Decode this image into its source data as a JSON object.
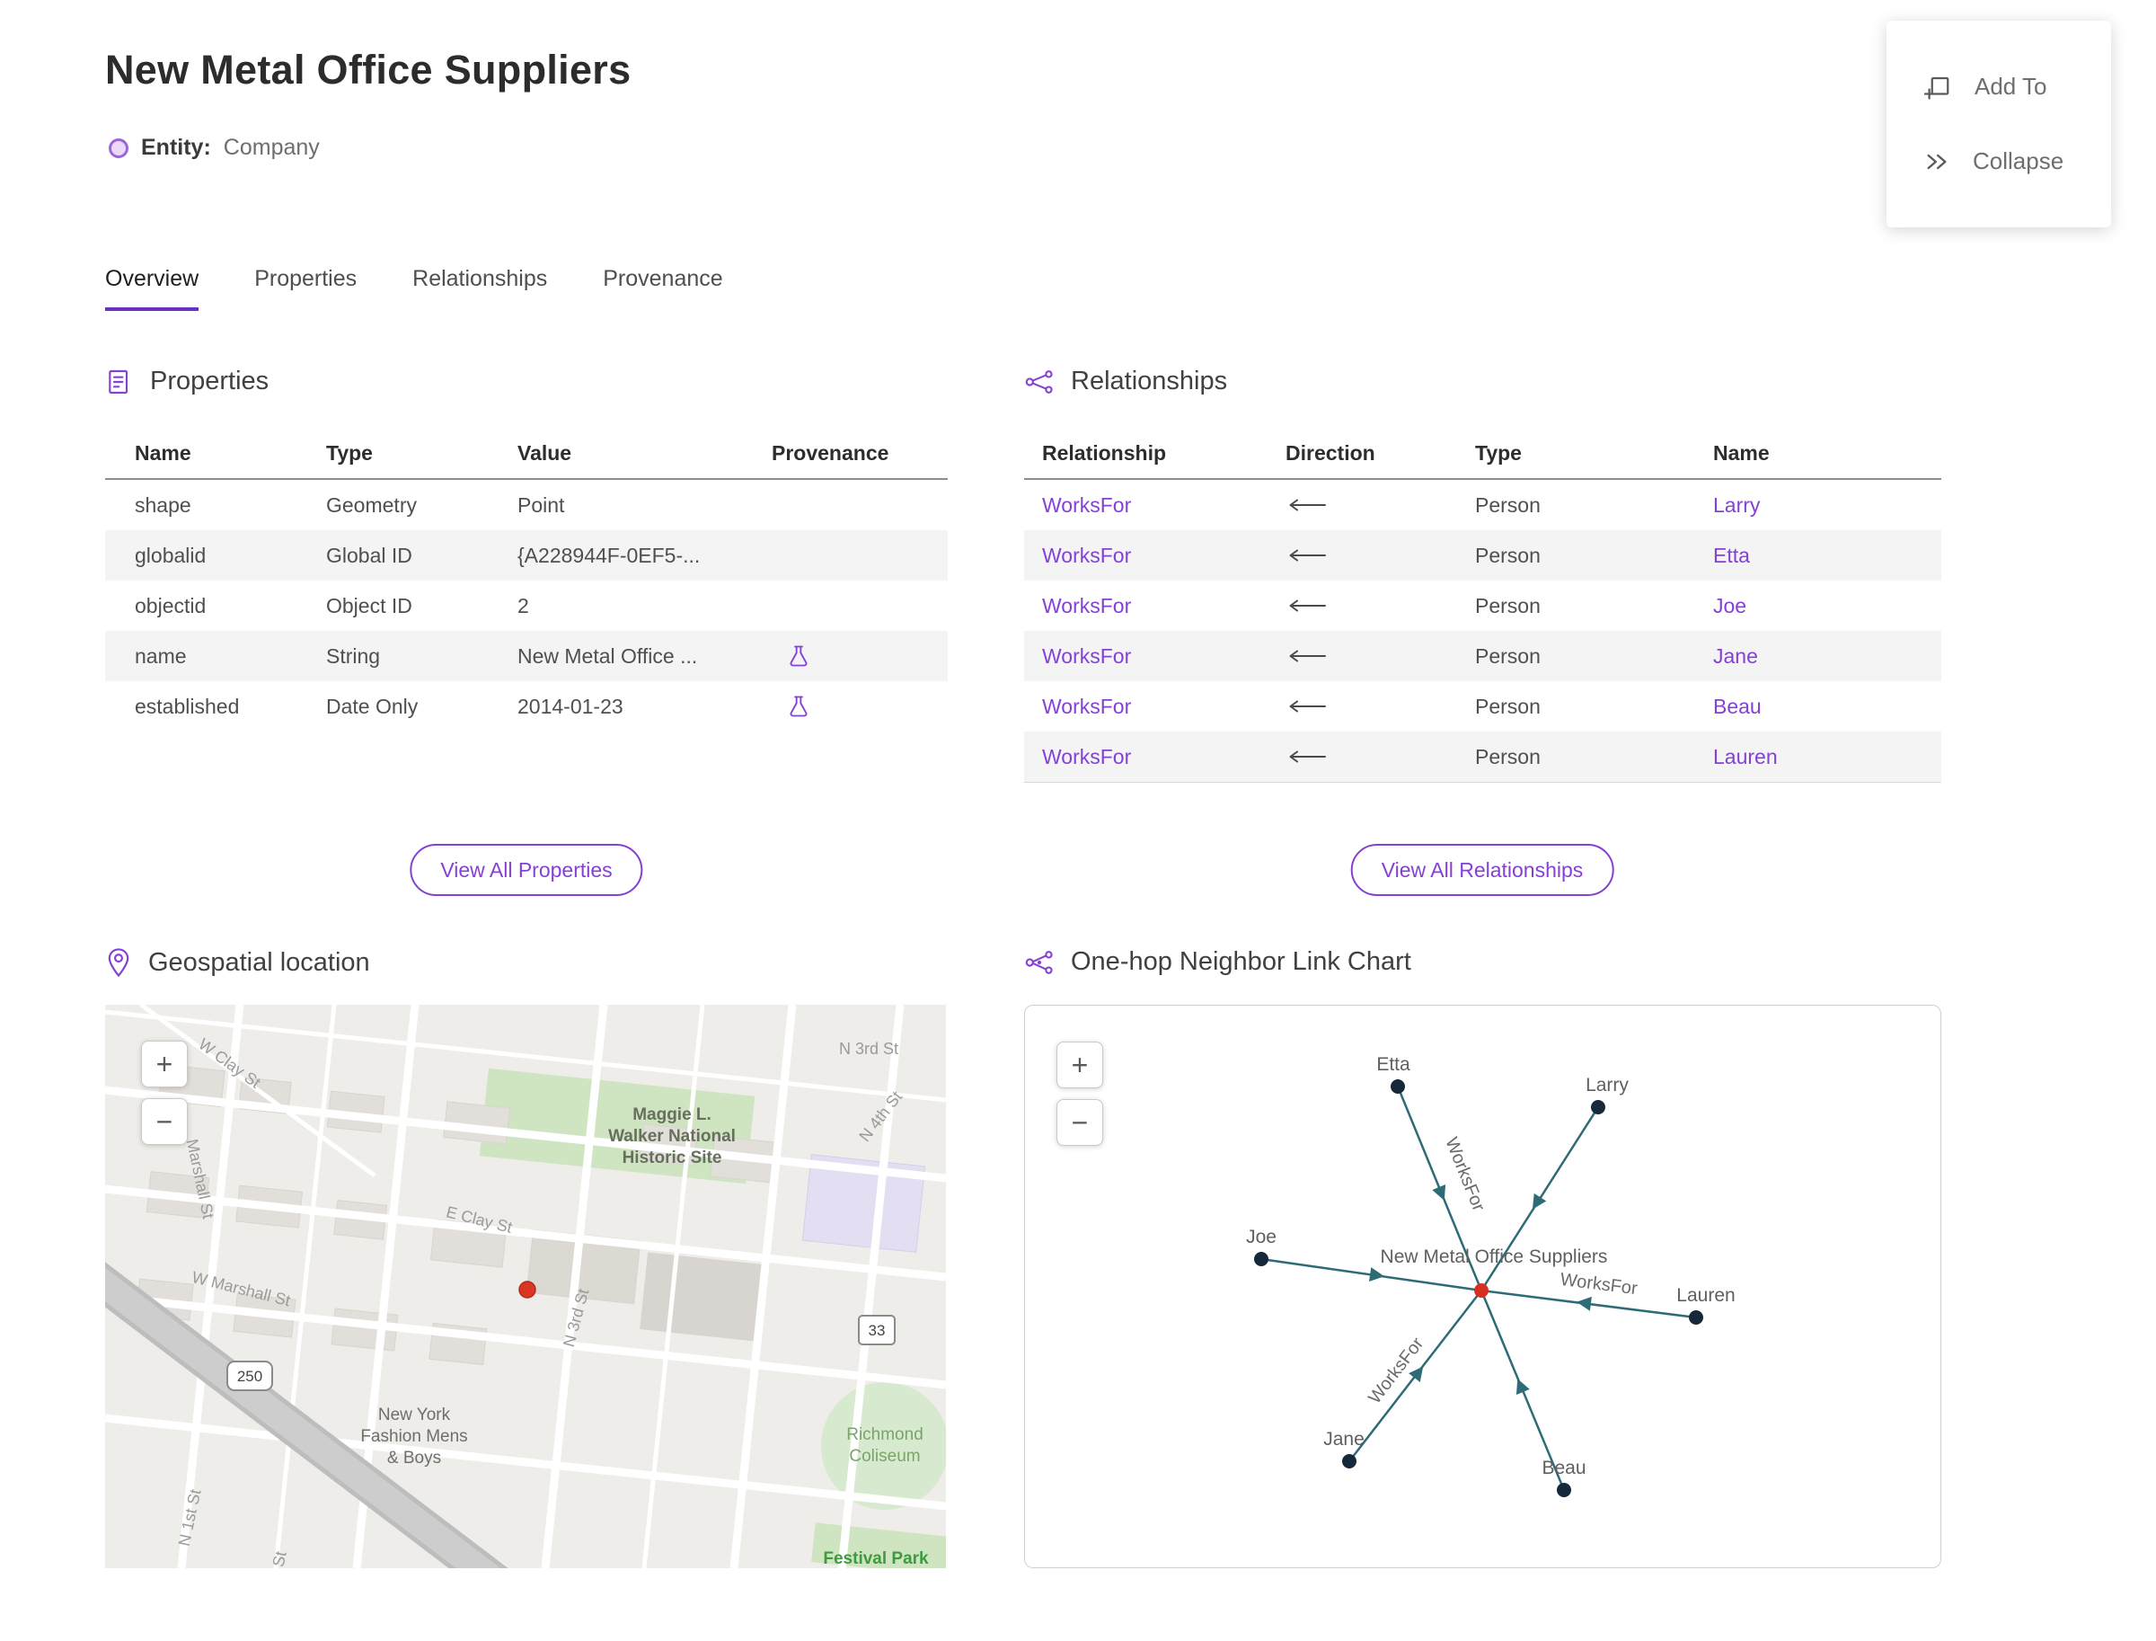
{
  "header": {
    "title": "New Metal Office Suppliers",
    "entity_label": "Entity:",
    "entity_type": "Company"
  },
  "action_panel": {
    "add_to": "Add To",
    "collapse": "Collapse"
  },
  "tabs": {
    "overview": "Overview",
    "properties": "Properties",
    "relationships": "Relationships",
    "provenance": "Provenance"
  },
  "properties": {
    "heading": "Properties",
    "col_name": "Name",
    "col_type": "Type",
    "col_value": "Value",
    "col_provenance": "Provenance",
    "rows": [
      {
        "name": "shape",
        "type": "Geometry",
        "value": "Point",
        "provenance": false
      },
      {
        "name": "globalid",
        "type": "Global ID",
        "value": "{A228944F-0EF5-...",
        "provenance": false
      },
      {
        "name": "objectid",
        "type": "Object ID",
        "value": "2",
        "provenance": false
      },
      {
        "name": "name",
        "type": "String",
        "value": "New Metal Office ...",
        "provenance": true
      },
      {
        "name": "established",
        "type": "Date Only",
        "value": "2014-01-23",
        "provenance": true
      }
    ],
    "view_all": "View All Properties"
  },
  "relationships": {
    "heading": "Relationships",
    "col_relationship": "Relationship",
    "col_direction": "Direction",
    "col_type": "Type",
    "col_name": "Name",
    "rows": [
      {
        "relationship": "WorksFor",
        "direction": "←",
        "type": "Person",
        "name": "Larry"
      },
      {
        "relationship": "WorksFor",
        "direction": "←",
        "type": "Person",
        "name": "Etta"
      },
      {
        "relationship": "WorksFor",
        "direction": "←",
        "type": "Person",
        "name": "Joe"
      },
      {
        "relationship": "WorksFor",
        "direction": "←",
        "type": "Person",
        "name": "Jane"
      },
      {
        "relationship": "WorksFor",
        "direction": "←",
        "type": "Person",
        "name": "Beau"
      },
      {
        "relationship": "WorksFor",
        "direction": "←",
        "type": "Person",
        "name": "Lauren"
      }
    ],
    "view_all": "View All Relationships"
  },
  "map": {
    "heading": "Geospatial location",
    "zoom_in": "+",
    "zoom_out": "−",
    "labels": {
      "n3rd_top": "N 3rd St",
      "n4th": "N 4th St",
      "maggie_1": "Maggie L.",
      "maggie_2": "Walker National",
      "maggie_3": "Historic Site",
      "w_clay": "W Clay St",
      "marshall": "Marshall St",
      "w_marshall": "W Marshall St",
      "e_clay": "E Clay St",
      "n3rd_mid": "N 3rd St",
      "n1st": "N 1st St",
      "st_frag": "St",
      "ny_1": "New York",
      "ny_2": "Fashion Mens",
      "ny_3": "& Boys",
      "coliseum_1": "Richmond",
      "coliseum_2": "Coliseum",
      "festival": "Festival Park",
      "route_250": "250",
      "route_33": "33"
    }
  },
  "link_chart": {
    "heading": "One-hop Neighbor Link Chart",
    "zoom_in": "+",
    "zoom_out": "−",
    "center_label": "New Metal Office Suppliers",
    "edge_label": "WorksFor",
    "nodes": {
      "etta": "Etta",
      "larry": "Larry",
      "joe": "Joe",
      "lauren": "Lauren",
      "jane": "Jane",
      "beau": "Beau"
    },
    "edges": [
      {
        "from": "Etta",
        "to": "New Metal Office Suppliers",
        "label": "WorksFor",
        "direction": "in"
      },
      {
        "from": "Larry",
        "to": "New Metal Office Suppliers",
        "label": "WorksFor",
        "direction": "in"
      },
      {
        "from": "Joe",
        "to": "New Metal Office Suppliers",
        "label": "WorksFor",
        "direction": "in"
      },
      {
        "from": "Lauren",
        "to": "New Metal Office Suppliers",
        "label": "WorksFor",
        "direction": "in"
      },
      {
        "from": "Jane",
        "to": "New Metal Office Suppliers",
        "label": "WorksFor",
        "direction": "in"
      },
      {
        "from": "Beau",
        "to": "New Metal Office Suppliers",
        "label": "WorksFor",
        "direction": "in"
      }
    ]
  },
  "colors": {
    "accent_purple": "#8540d4",
    "tab_underline": "#6a30c2",
    "edge_teal": "#2d6b76",
    "node_navy": "#15293b",
    "center_node_red": "#d83020",
    "map_marker_red": "#d83723",
    "row_alt": "#f4f4f4"
  }
}
